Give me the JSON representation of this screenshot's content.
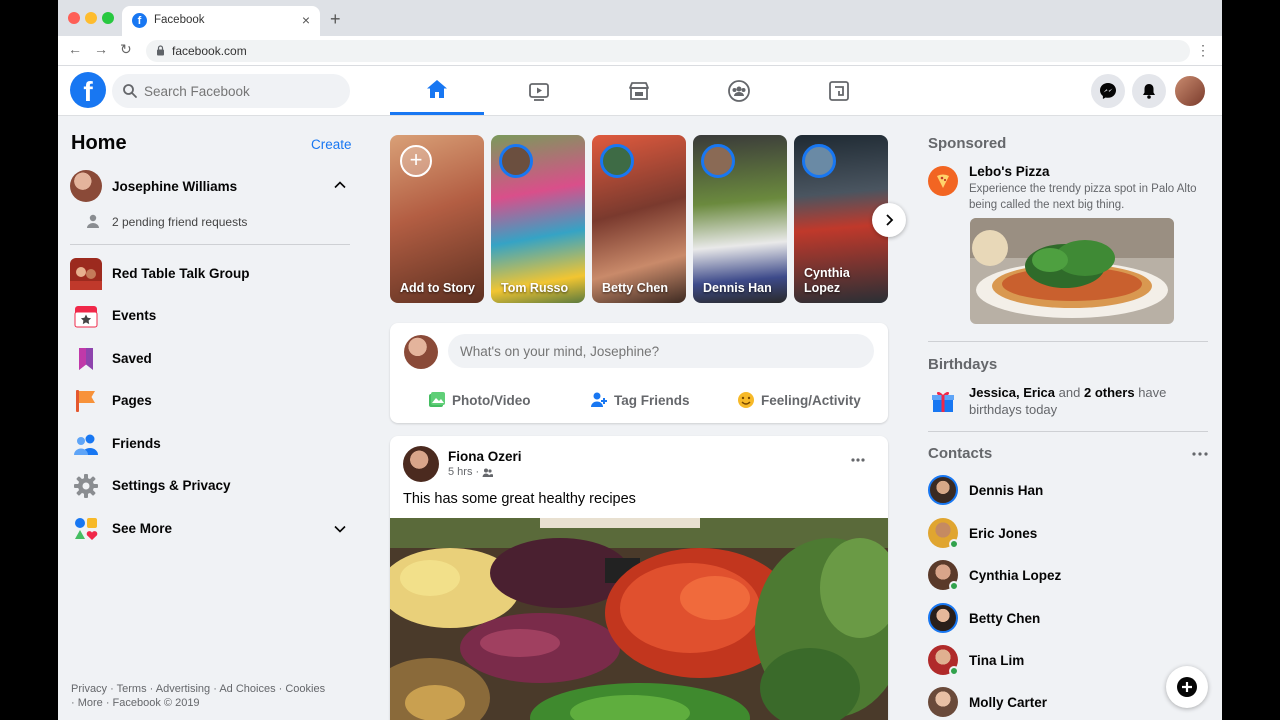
{
  "browser": {
    "tab_title": "Facebook",
    "url": "facebook.com"
  },
  "header": {
    "search_placeholder": "Search Facebook",
    "nav_tabs": [
      "home",
      "watch",
      "marketplace",
      "groups",
      "gaming"
    ],
    "active_tab": "home"
  },
  "sidebar": {
    "title": "Home",
    "create_label": "Create",
    "user_name": "Josephine Williams",
    "pending_requests": "2 pending friend requests",
    "items": [
      {
        "label": "Red Table Talk Group",
        "icon": "group-thumbnail-icon"
      },
      {
        "label": "Events",
        "icon": "calendar-icon"
      },
      {
        "label": "Saved",
        "icon": "bookmark-icon"
      },
      {
        "label": "Pages",
        "icon": "flag-icon"
      },
      {
        "label": "Friends",
        "icon": "friends-icon"
      },
      {
        "label": "Settings & Privacy",
        "icon": "gear-icon"
      },
      {
        "label": "See More",
        "icon": "see-more-icon"
      }
    ],
    "footer_line1": "Privacy · Terms · Advertising · Ad Choices · Cookies",
    "footer_line2": "· More · Facebook © 2019"
  },
  "stories": [
    {
      "name": "Add to Story",
      "type": "add"
    },
    {
      "name": "Tom Russo"
    },
    {
      "name": "Betty Chen"
    },
    {
      "name": "Dennis Han"
    },
    {
      "name": "Cynthia Lopez"
    }
  ],
  "composer": {
    "placeholder": "What's on your mind, Josephine?",
    "actions": [
      "Photo/Video",
      "Tag Friends",
      "Feeling/Activity"
    ]
  },
  "post": {
    "author": "Fiona Ozeri",
    "time": "5 hrs",
    "text": "This has some great healthy recipes"
  },
  "right": {
    "sponsored_title": "Sponsored",
    "sponsor_name": "Lebo's Pizza",
    "sponsor_desc": "Experience the trendy pizza spot in Palo Alto being called the next big thing.",
    "birthdays_title": "Birthdays",
    "birthday_names": "Jessica, Erica",
    "birthday_and": "and",
    "birthday_others": "2 others",
    "birthday_suffix": "have birthdays today",
    "contacts_title": "Contacts",
    "contacts": [
      {
        "name": "Dennis Han",
        "online": false,
        "story": true
      },
      {
        "name": "Eric Jones",
        "online": true,
        "story": false
      },
      {
        "name": "Cynthia Lopez",
        "online": true,
        "story": false
      },
      {
        "name": "Betty Chen",
        "online": false,
        "story": true
      },
      {
        "name": "Tina Lim",
        "online": true,
        "story": false
      },
      {
        "name": "Molly Carter",
        "online": false,
        "story": false
      }
    ]
  },
  "colors": {
    "brand": "#1877f2",
    "background": "#f0f2f5",
    "online": "#31a24c"
  }
}
